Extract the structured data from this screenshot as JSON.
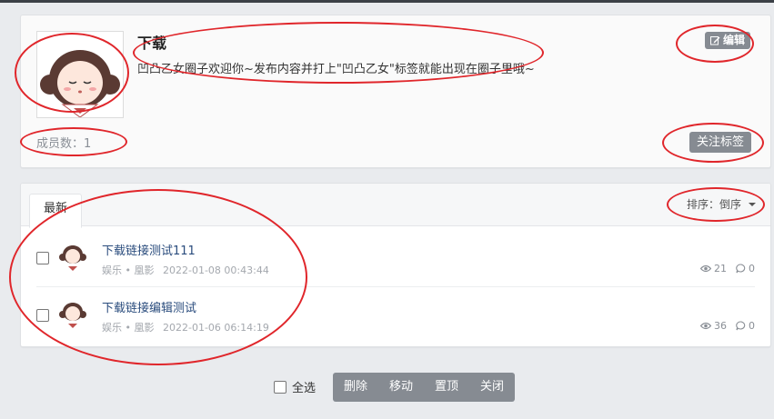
{
  "circle": {
    "title": "下载",
    "description": "凹凸乙女圈子欢迎你~发布内容并打上\"凹凸乙女\"标签就能出现在圈子里哦~",
    "edit_label": "编辑",
    "members_label": "成员数：1",
    "follow_label": "关注标签"
  },
  "tabs": [
    {
      "label": "最新"
    }
  ],
  "sort": {
    "label": "排序：倒序"
  },
  "posts": [
    {
      "title": "下载链接测试111",
      "category": "娱乐",
      "author": "凰影",
      "date": "2022-01-08 00:43:44",
      "views": "21",
      "comments": "0"
    },
    {
      "title": "下载链接编辑测试",
      "category": "娱乐",
      "author": "凰影",
      "date": "2022-01-06 06:14:19",
      "views": "36",
      "comments": "0"
    }
  ],
  "actions": {
    "select_all": "全选",
    "delete": "删除",
    "move": "移动",
    "pin": "置顶",
    "close": "关闭"
  },
  "colors": {
    "button_gray": "#868b92",
    "annotation_red": "#e0262b",
    "link_blue": "#2a4c7d"
  }
}
